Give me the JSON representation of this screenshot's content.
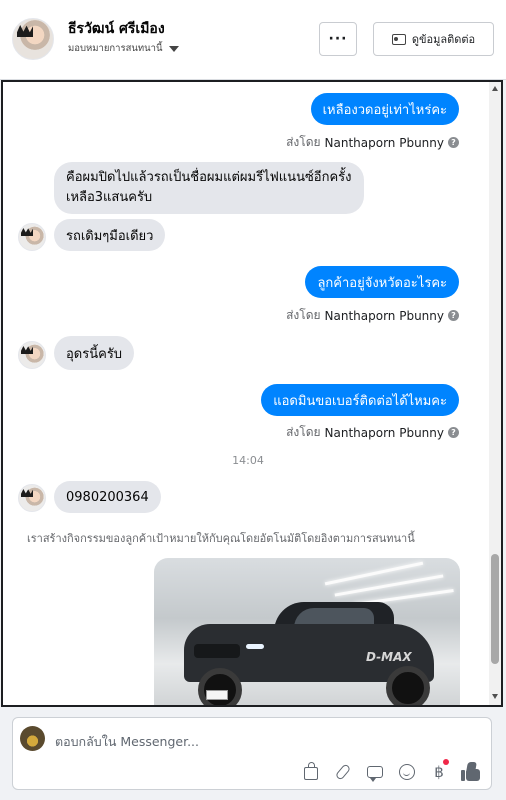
{
  "header": {
    "name": "ธีรวัฒน์ ศรีเมือง",
    "assign_label": "มอบหมายการสนทนานี้",
    "more_label": "···",
    "contact_label": "ดูข้อมูลติดต่อ"
  },
  "messages": [
    {
      "direction": "out",
      "text": "เหลืองวดอยู่เท่าไหร่คะ",
      "sent_by_prefix": "ส่งโดย",
      "sent_by": "Nanthaporn Pbunny"
    },
    {
      "direction": "in",
      "text": "คือผมปิดไปแล้วรถเป็นชื่อผมแต่ผมรีไฟแนนซ์อีกครั้ง เหลือ3แสนครับ"
    },
    {
      "direction": "in",
      "text": "รถเดิมๆมือเดียว"
    },
    {
      "direction": "out",
      "text": "ลูกค้าอยู่จังหวัดอะไรคะ",
      "sent_by_prefix": "ส่งโดย",
      "sent_by": "Nanthaporn Pbunny"
    },
    {
      "direction": "in",
      "text": "อุดรนี้ครับ"
    },
    {
      "direction": "out",
      "text": "แอดมินขอเบอร์ติดต่อได้ไหมคะ",
      "sent_by_prefix": "ส่งโดย",
      "sent_by": "Nanthaporn Pbunny"
    },
    {
      "direction": "in",
      "text": "0980200364"
    }
  ],
  "timestamp": "14:04",
  "notice": "เราสร้างกิจกรรมของลูกค้าเป้าหมายให้กับคุณโดยอัตโนมัติโดยอิงตามการสนทนานี้",
  "photo": {
    "badge_text": "D-MAX",
    "alt": "pickup truck photo"
  },
  "composer": {
    "placeholder": "ตอบกลับใน Messenger..."
  },
  "colors": {
    "accent": "#0084ff",
    "incoming_bubble": "#e4e6eb",
    "notification_dot": "#f02849"
  }
}
